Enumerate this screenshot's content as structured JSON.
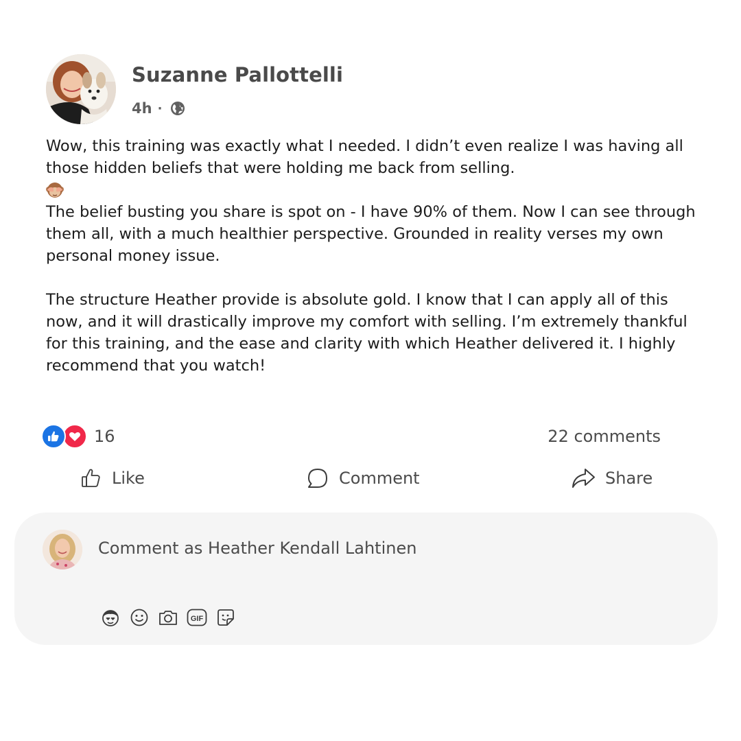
{
  "post": {
    "author": {
      "name": "Suzanne Pallottelli",
      "avatar": "profile-photo-woman-with-dog"
    },
    "meta": {
      "time": "4h",
      "separator": "·",
      "audience_icon": "globe-icon"
    },
    "body": {
      "paragraph_1": "Wow, this training was exactly what I needed. I didn’t even realize I was having all those hidden beliefs that were holding me back from selling.",
      "emoji": "see-no-evil-monkey-icon",
      "paragraph_2": "The belief busting you share is spot on - I have 90% of them. Now I can see through them all, with a much healthier perspective. Grounded in reality verses my own personal money issue.",
      "paragraph_3": "The structure Heather provide is absolute gold. I know that I can apply all of this now, and it will drastically improve my comfort with selling. I’m extremely thankful for this training, and the ease and clarity with which Heather delivered it. I highly recommend that you watch!"
    },
    "reactions": {
      "types": [
        "like-icon",
        "love-icon"
      ],
      "count": "16"
    },
    "comments_count": "22 comments",
    "actions": {
      "like_label": "Like",
      "comment_label": "Comment",
      "share_label": "Share"
    }
  },
  "composer": {
    "placeholder": "Comment as Heather Kendall Lahtinen",
    "avatar": "profile-photo-blonde-woman",
    "tools": [
      "avatar-sticker-icon",
      "emoji-icon",
      "camera-icon",
      "gif-icon",
      "sticker-icon"
    ],
    "gif_label": "GIF"
  },
  "colors": {
    "like_blue": "#1b74e4",
    "love_red": "#f02849",
    "composer_bg": "#f5f5f5",
    "text_gray": "#4b4b4b"
  }
}
